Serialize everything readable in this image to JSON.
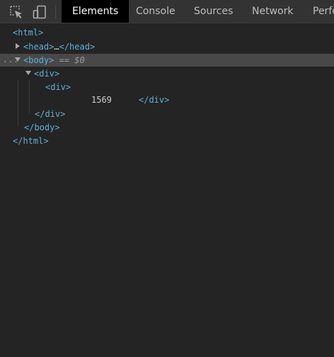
{
  "toolbar": {
    "icons": [
      "inspect-element-icon",
      "device-toolbar-icon"
    ],
    "tabs": [
      {
        "label": "Elements",
        "active": true
      },
      {
        "label": "Console",
        "active": false
      },
      {
        "label": "Sources",
        "active": false
      },
      {
        "label": "Network",
        "active": false
      },
      {
        "label": "Perfo",
        "active": false
      }
    ]
  },
  "tree": {
    "html_open": "<html>",
    "head_open": "<head>",
    "head_ellipsis": "…",
    "head_close": "</head>",
    "body_open": "<body>",
    "body_hint": "== $0",
    "row_dots": "...",
    "div_outer_open": "<div>",
    "div_inner_open": "<div>",
    "div_inner_text": "1569",
    "div_inner_close": "</div>",
    "div_outer_close": "</div>",
    "body_close": "</body>",
    "html_close": "</html>"
  },
  "colors": {
    "background": "#242424",
    "toolbar": "#333333",
    "active_tab": "#000000",
    "tag": "#5db0d7",
    "text": "#cfcfcf",
    "selection": "#484848"
  }
}
